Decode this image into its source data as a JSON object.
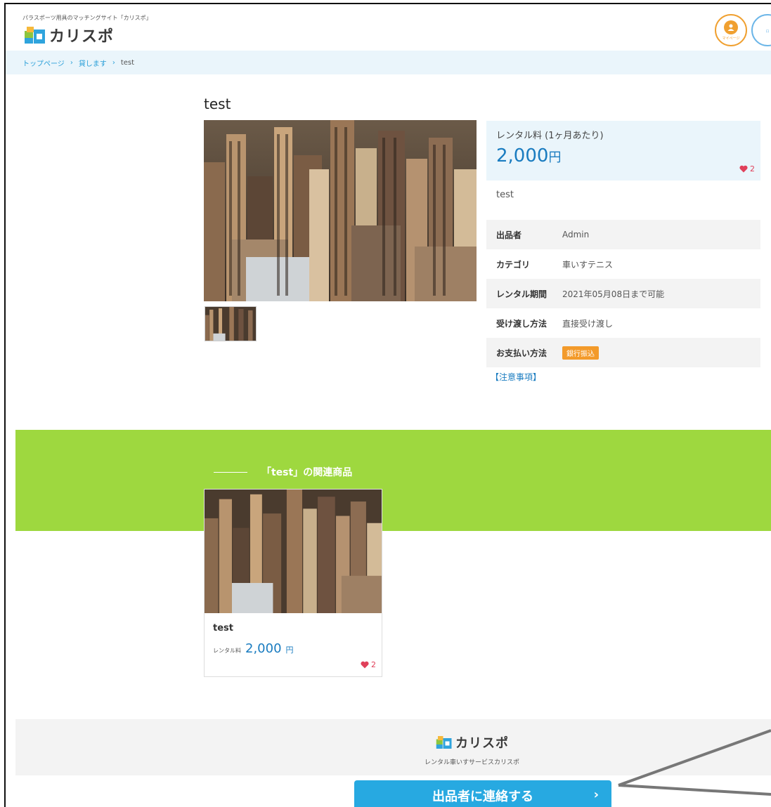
{
  "header": {
    "tagline": "パラスポーツ用具のマッチングサイト「カリスポ」",
    "logo_text": "カリスポ",
    "mypage_caption": "マイページ",
    "second_button_caption": "ロ"
  },
  "breadcrumb": {
    "items": [
      "トップページ",
      "貸します",
      "test"
    ],
    "separator": "›"
  },
  "product": {
    "title": "test",
    "price_label": "レンタル料 (1ヶ月あたり)",
    "price_value": "2,000",
    "price_unit": "円",
    "likes": "2",
    "description": "test",
    "specs": [
      {
        "key": "出品者",
        "value": "Admin"
      },
      {
        "key": "カテゴリ",
        "value": "車いすテニス"
      },
      {
        "key": "レンタル期間",
        "value": "2021年05月08日まで可能"
      },
      {
        "key": "受け渡し方法",
        "value": "直接受け渡し"
      },
      {
        "key": "お支払い方法",
        "value": "銀行振込"
      }
    ],
    "notice_link": "【注意事項】"
  },
  "related": {
    "heading": "「test」の関連商品",
    "card": {
      "title": "test",
      "price_label": "レンタル料",
      "price_value": "2,000",
      "price_unit": "円",
      "likes": "2"
    }
  },
  "footer": {
    "logo_text": "カリスポ",
    "subtitle": "レンタル車いすサービスカリスポ"
  },
  "cta": {
    "label": "出品者に連絡する",
    "chevron": "›"
  },
  "colors": {
    "accent_blue": "#27a9e1",
    "price_blue": "#1a7cc0",
    "band_green": "#9ed83f",
    "badge_orange": "#f39a2a",
    "heart_red": "#e0405a"
  }
}
